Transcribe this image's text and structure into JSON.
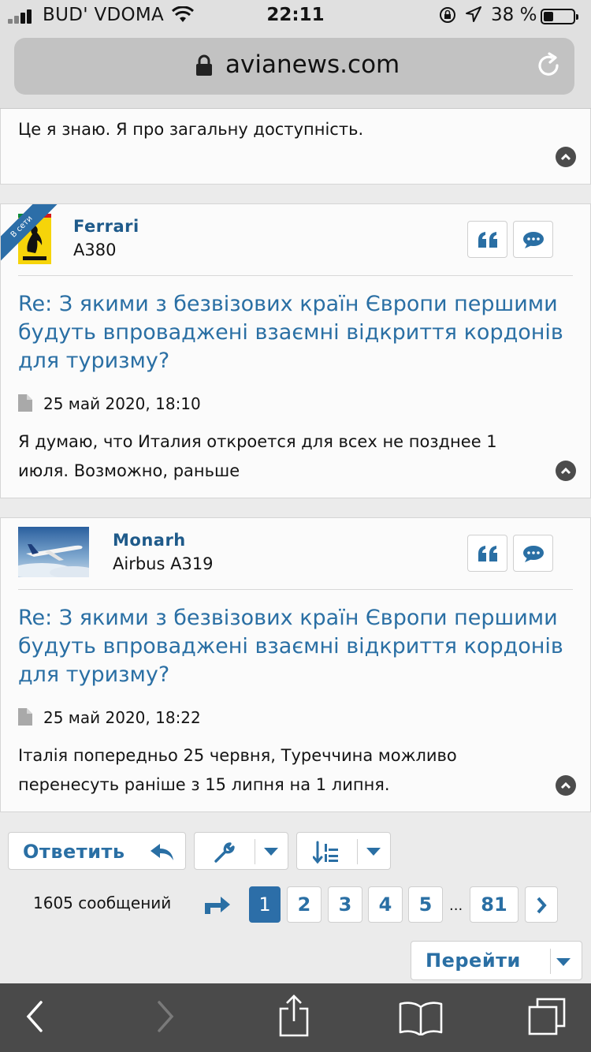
{
  "status_bar": {
    "carrier": "BUD' VDOMA",
    "time": "22:11",
    "battery_percent": "38 %"
  },
  "url_bar": {
    "domain": "avianews.com"
  },
  "post_prev": {
    "body": "Це я знаю. Я про загальну доступність."
  },
  "posts": [
    {
      "username": "Ferrari",
      "user_title": "A380",
      "online_badge": "В сети",
      "title": "Re: З якими з безвізових країн Європи першими будуть впроваджені взаємні відкриття кордонів для туризму?",
      "date": "25 май 2020, 18:10",
      "body": "Я думаю, что Италия откроется для всех не позднее 1 июля. Возможно, раньше"
    },
    {
      "username": "Monarh",
      "user_title": "Airbus A319",
      "title": "Re: З якими з безвізових країн Європи першими будуть впроваджені взаємні відкриття кордонів для туризму?",
      "date": "25 май 2020, 18:22",
      "body": "Італія попередньо 25 червня, Туреччина можливо перенесуть раніше з 15 липня на 1 липня."
    }
  ],
  "controls": {
    "reply_label": "Ответить",
    "message_count": "1605 сообщений",
    "pages": [
      "1",
      "2",
      "3",
      "4",
      "5",
      "81"
    ],
    "current_page": "1",
    "ellipsis": "...",
    "go_label": "Перейти"
  },
  "icons": {
    "quote": "quote-icon",
    "reply": "comment-icon",
    "collapse": "chevron-up-icon",
    "tools": "wrench-icon",
    "sort": "sort-numeric-icon",
    "jump": "jump-arrow-icon",
    "next": "chevron-right-icon"
  },
  "colors": {
    "link_blue": "#2a6fa4",
    "accent_blue": "#2c6ea8",
    "toolbar": "#4a4a4a"
  }
}
